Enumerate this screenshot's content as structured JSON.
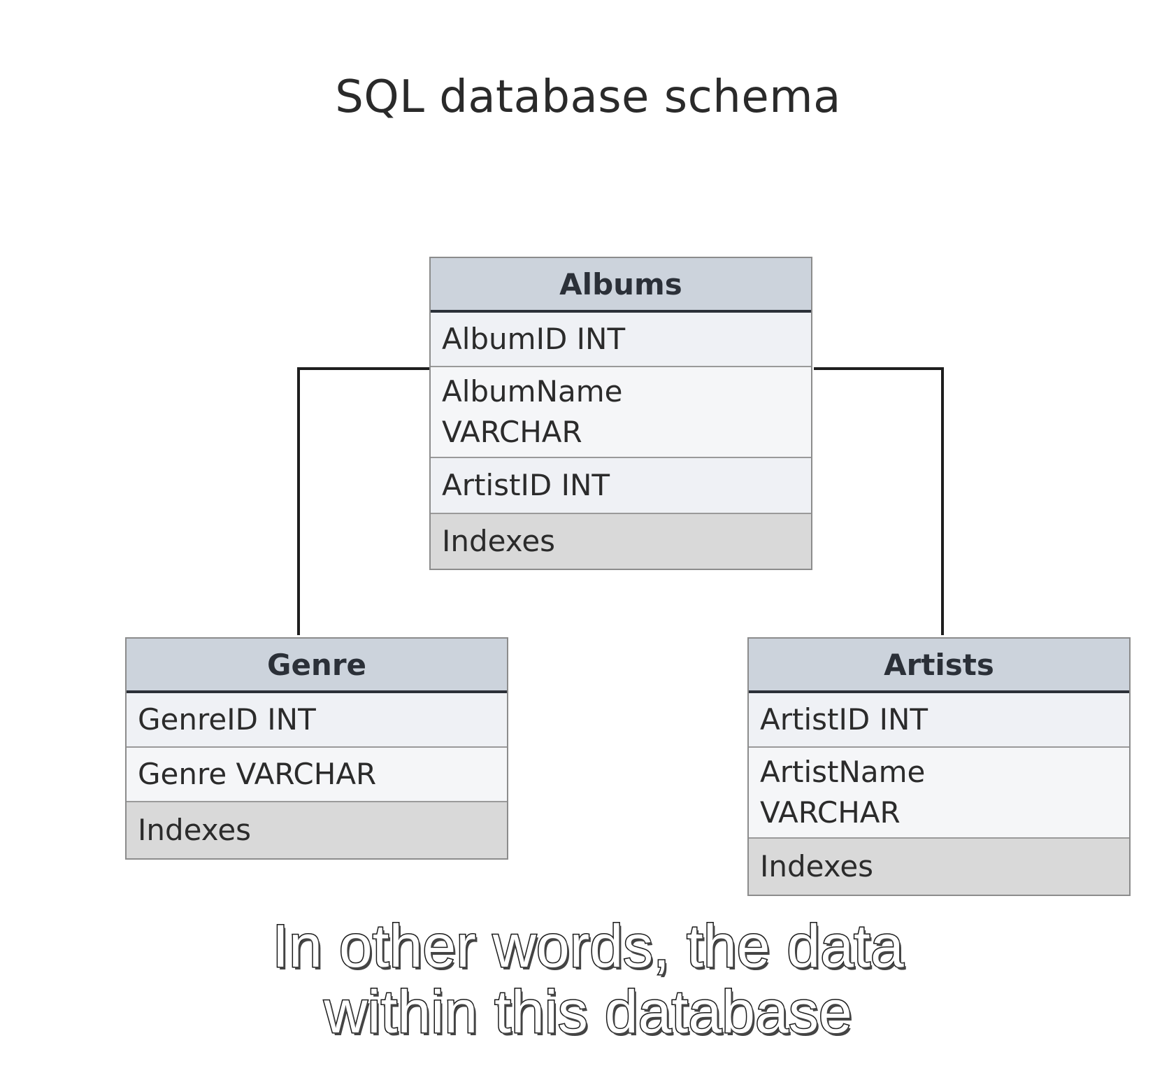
{
  "title": "SQL database schema",
  "tables": {
    "albums": {
      "name": "Albums",
      "fields": [
        "AlbumID INT",
        "AlbumName\nVARCHAR",
        "ArtistID INT"
      ],
      "indexes": "Indexes"
    },
    "genre": {
      "name": "Genre",
      "fields": [
        "GenreID INT",
        "Genre VARCHAR"
      ],
      "indexes": "Indexes"
    },
    "artists": {
      "name": "Artists",
      "fields": [
        "ArtistID INT",
        "ArtistName\nVARCHAR"
      ],
      "indexes": "Indexes"
    }
  },
  "caption": {
    "line1": "In other words, the data",
    "line2": "within this database"
  }
}
